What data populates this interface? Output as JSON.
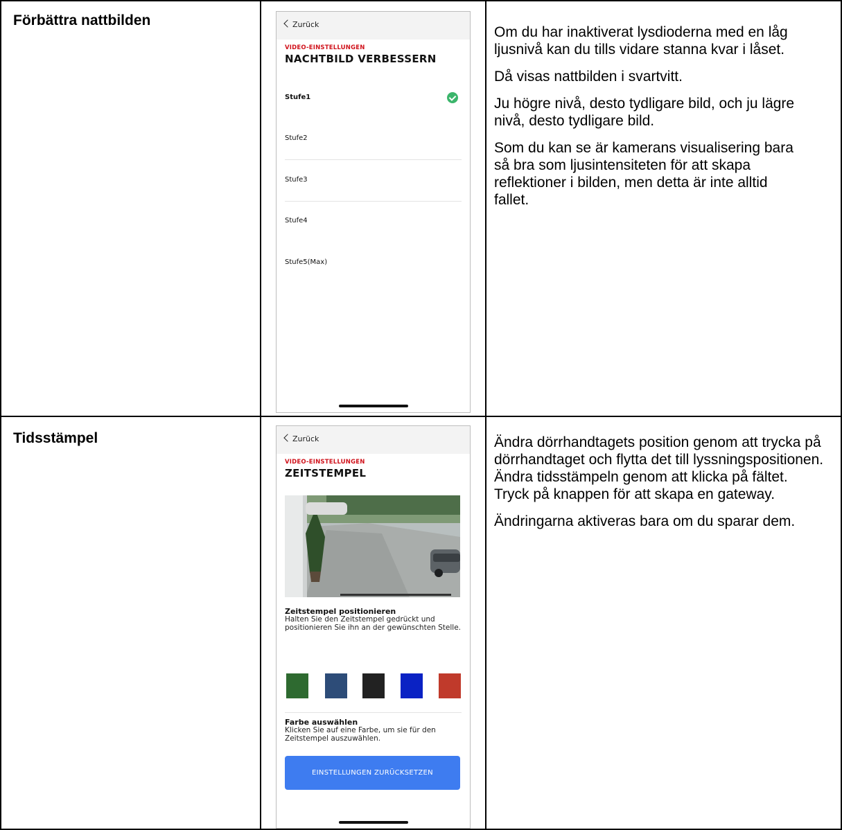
{
  "rows": [
    {
      "title": "Förbättra nattbilden",
      "phone": {
        "back_label": "Zurück",
        "section": "VIDEO-EINSTELLUNGEN",
        "heading": "NACHTBILD VERBESSERN",
        "levels": [
          "Stufe1",
          "Stufe2",
          "Stufe3",
          "Stufe4",
          "Stufe5(Max)"
        ],
        "selected_level": "Stufe1"
      },
      "description": [
        "Om du har inaktiverat lysdioderna med en låg ljusnivå kan du tills vidare stanna kvar i låset.",
        "Då visas nattbilden i svartvitt.",
        "Ju högre nivå, desto tydligare bild, och ju lägre nivå, desto tydligare bild.",
        "Som du kan se är kamerans visualisering bara så bra som ljusintensiteten för att skapa reflektioner i bilden, men detta är inte alltid fallet."
      ]
    },
    {
      "title": "Tidsstämpel",
      "phone": {
        "back_label": "Zurück",
        "section": "VIDEO-EINSTELLUNGEN",
        "heading": "ZEITSTEMPEL",
        "position_title": "Zeitstempel positionieren",
        "position_text": "Halten Sie den Zeitstempel gedrückt und positionieren Sie ihn an der gewünschten Stelle.",
        "swatch_colors": [
          "#2e6a30",
          "#2d4c78",
          "#222222",
          "#0a22c4",
          "#c03a2b"
        ],
        "color_title": "Farbe auswählen",
        "color_text": "Klicken Sie auf eine Farbe, um sie für den Zeitstempel auszuwählen.",
        "reset_label": "EINSTELLUNGEN ZURÜCKSETZEN"
      },
      "description": [
        "Ändra dörrhandtagets position genom att trycka på dörrhandtaget och flytta det till lyssningspositionen. Ändra tidsstämpeln genom att klicka på fältet. Tryck på knappen för att skapa en gateway.",
        "Ändringarna aktiveras bara om du sparar dem."
      ]
    }
  ]
}
